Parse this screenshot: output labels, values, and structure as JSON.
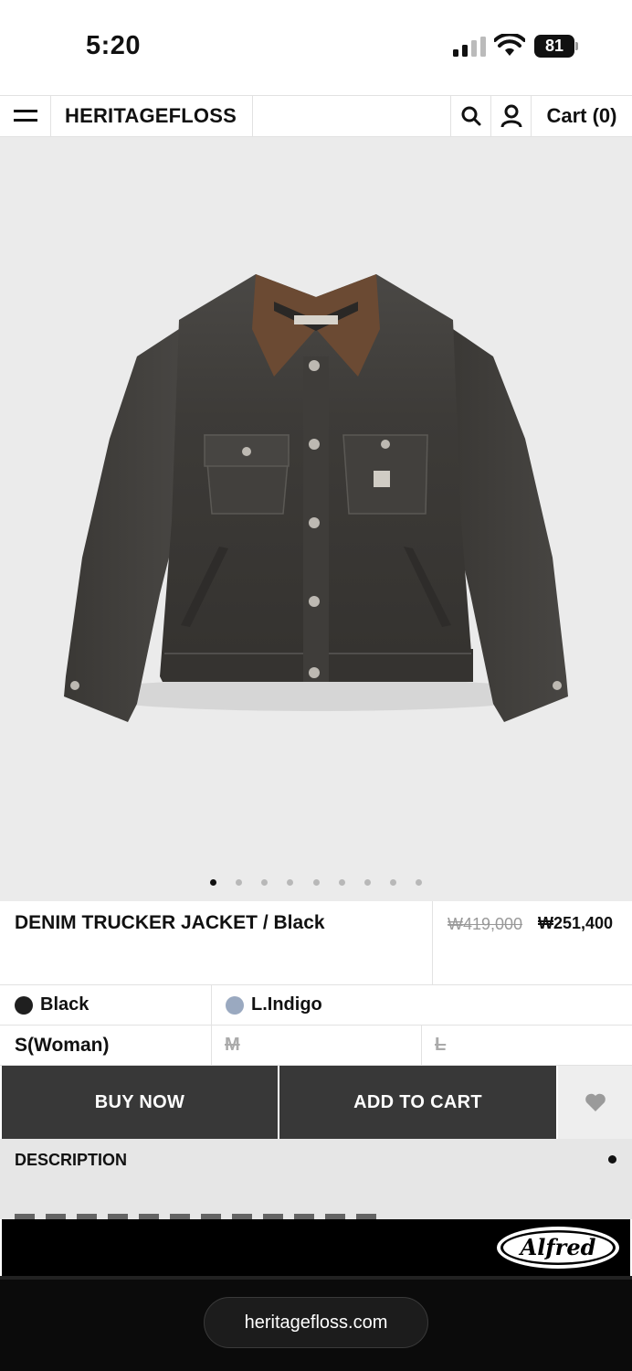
{
  "status": {
    "time": "5:20",
    "battery": "81"
  },
  "header": {
    "brand": "HERITAGEFLOSS",
    "cart": "Cart (0)"
  },
  "gallery": {
    "slide_count": 9,
    "active_index": 0,
    "background": "#ebebeb"
  },
  "product": {
    "title": "DENIM TRUCKER JACKET / Black",
    "price_original": "₩419,000",
    "price_sale": "₩251,400"
  },
  "colors": [
    {
      "label": "Black",
      "swatch": "#1f1f1f"
    },
    {
      "label": "L.Indigo",
      "swatch": "#9aa9c0"
    }
  ],
  "sizes": [
    {
      "label": "S(Woman)",
      "available": true
    },
    {
      "label": "M",
      "available": false
    },
    {
      "label": "L",
      "available": false
    }
  ],
  "actions": {
    "buy_now": "BUY NOW",
    "add_to_cart": "ADD TO CART"
  },
  "description": {
    "title": "DESCRIPTION"
  },
  "banner": {
    "logo": "Alfred"
  },
  "browser": {
    "url": "heritagefloss.com"
  },
  "theme": {
    "button_bg": "#383838",
    "accent_text": "#ffffff"
  }
}
